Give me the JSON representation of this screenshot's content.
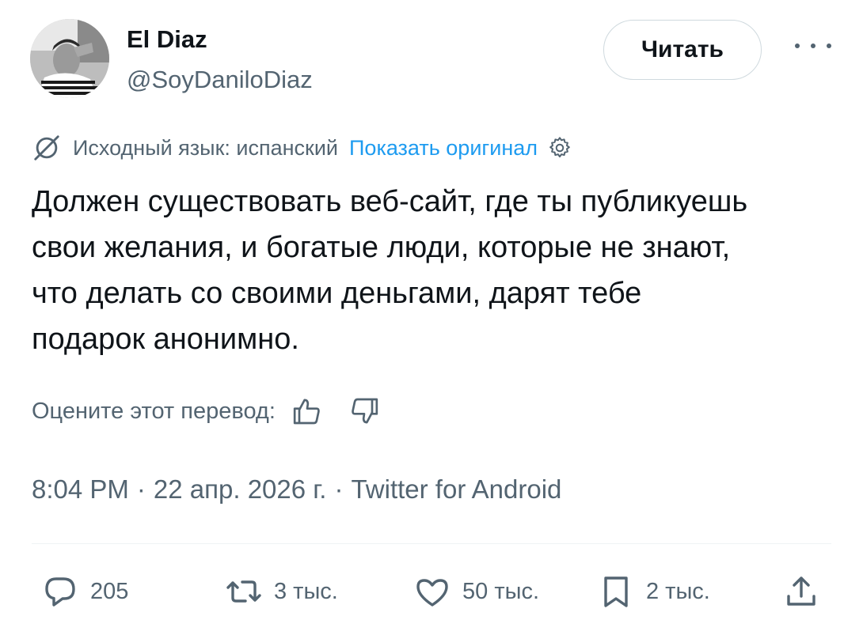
{
  "author": {
    "name": "El Diaz",
    "handle": "@SoyDaniloDiaz",
    "avatar_alt": "profile-photo"
  },
  "follow_button": {
    "label": "Читать"
  },
  "translation": {
    "source_language": "Исходный язык: испанский",
    "show_original": "Показать оригинал"
  },
  "tweet": {
    "text": "Должен существовать веб-сайт, где ты публикуешь\nсвои желания, и богатые люди, которые не знают,\nчто делать со своими деньгами, дарят тебе\nподарок анонимно."
  },
  "rating": {
    "prompt": "Оцените этот перевод:"
  },
  "meta": {
    "time": "8:04 PM",
    "date": "22 апр. 2026 г.",
    "source": "Twitter for Android",
    "separator": "·"
  },
  "actions": {
    "replies": "205",
    "retweets": "3 тыс.",
    "likes": "50 тыс.",
    "bookmarks": "2 тыс."
  },
  "colors": {
    "text": "#0f1419",
    "secondary": "#536471",
    "link": "#1d9bf0",
    "border": "#cfd9de"
  }
}
